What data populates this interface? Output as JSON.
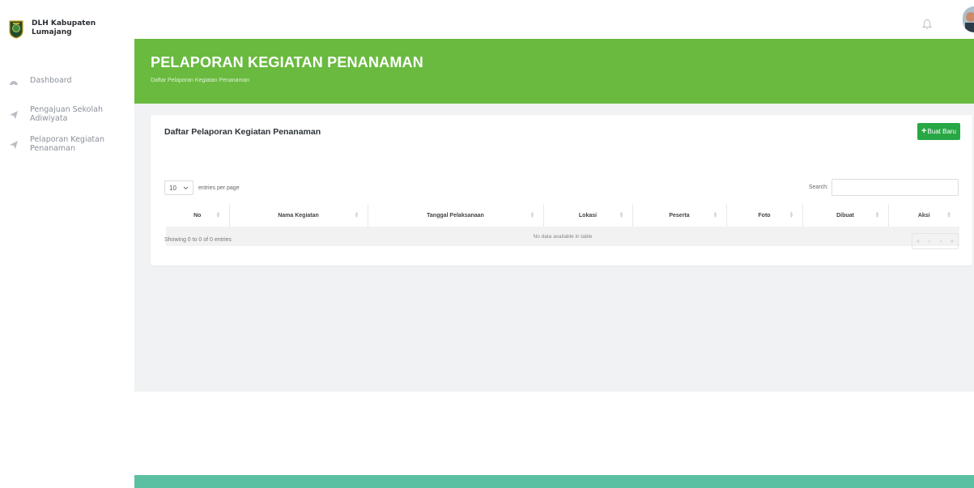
{
  "brand": {
    "name": "DLH Kabupaten Lumajang"
  },
  "sidebar": {
    "items": [
      {
        "label": "Dashboard",
        "icon": "dashboard-icon"
      },
      {
        "label": "Pengajuan Sekolah Adiwiyata",
        "icon": "send-icon"
      },
      {
        "label": "Pelaporan Kegiatan Penanaman",
        "icon": "send-icon"
      }
    ]
  },
  "header": {
    "title": "PELAPORAN KEGIATAN PENANAMAN",
    "subtitle": "Daftar Pelaporan Kegiatan Penanaman"
  },
  "card": {
    "title": "Daftar Pelaporan Kegiatan Penanaman",
    "new_button": "Buat Baru"
  },
  "table_controls": {
    "page_length": "10",
    "length_label": "entries per page",
    "search_label": "Search:",
    "search_value": ""
  },
  "table": {
    "columns": [
      "No",
      "Nama Kegiatan",
      "Tanggal Pelaksanaan",
      "Lokasi",
      "Peserta",
      "Foto",
      "Dibuat",
      "Aksi"
    ],
    "empty_text": "No data available in table"
  },
  "footer_info": {
    "showing": "Showing 0 to 0 of 0 entries",
    "pager": [
      "«",
      "‹",
      "›",
      "»"
    ]
  },
  "colors": {
    "header_green": "#69ba3f",
    "button_green": "#28a745",
    "footer_teal": "#5bc0a2"
  }
}
